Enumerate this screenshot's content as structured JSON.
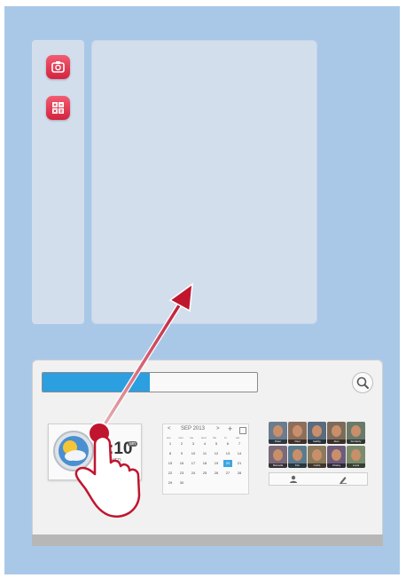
{
  "progress": {
    "value": 0.5
  },
  "icons": {
    "sidebar": [
      "camera-icon",
      "calculator-icon"
    ],
    "search": "search-icon",
    "weather": "weather-icon",
    "contacts_add": "add-contact-icon",
    "contacts_edit": "edit-icon"
  },
  "weather": {
    "time": ":10",
    "badge": "am",
    "sub": "WED"
  },
  "calendar": {
    "prev": "<",
    "month": "SEP 2013",
    "next": ">",
    "add": "+",
    "weekdays": [
      "sun",
      "mon",
      "tue",
      "wed",
      "thu",
      "fri",
      "sat"
    ],
    "days": [
      "1",
      "2",
      "3",
      "4",
      "5",
      "6",
      "7",
      "8",
      "9",
      "10",
      "11",
      "12",
      "13",
      "14",
      "15",
      "16",
      "17",
      "18",
      "19",
      "20",
      "21",
      "22",
      "23",
      "24",
      "25",
      "26",
      "27",
      "28",
      "29",
      "30"
    ],
    "today": "20"
  },
  "contacts": {
    "names": [
      "Peter",
      "Paul",
      "Gabby",
      "Alan",
      "Kimberly",
      "Marcella",
      "Kim",
      "Curtis",
      "Chelsy",
      "Louis"
    ]
  },
  "colors": {
    "accent": "#2b9fe0",
    "gesture": "#c0152f",
    "background": "#a9c8e8"
  }
}
